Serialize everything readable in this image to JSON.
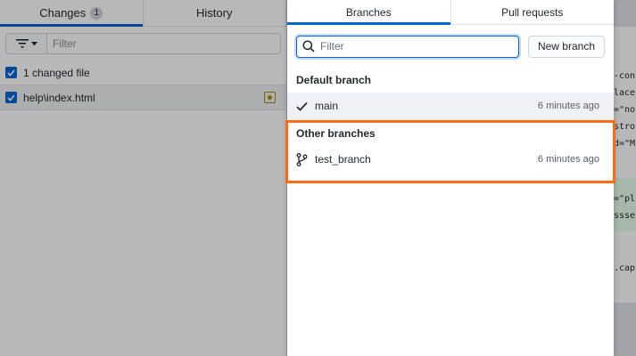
{
  "left_pane": {
    "tabs": [
      {
        "label": "Changes",
        "count": "1"
      },
      {
        "label": "History"
      }
    ],
    "filter_placeholder": "Filter",
    "changed_summary": "1 changed file",
    "files": [
      {
        "path": "help\\index.html",
        "status": "modified"
      }
    ]
  },
  "diff_snippets": [
    "-cont",
    "lacehc",
    "=\"non",
    "stro",
    "d=\"M",
    "=\"pl",
    "ssset",
    ".capt"
  ],
  "branch_popover": {
    "tabs": [
      {
        "label": "Branches"
      },
      {
        "label": "Pull requests"
      }
    ],
    "search_placeholder": "Filter",
    "new_branch_label": "New branch",
    "default_section": {
      "heading": "Default branch",
      "branches": [
        {
          "name": "main",
          "time": "6 minutes ago",
          "icon": "check-icon"
        }
      ]
    },
    "other_section": {
      "heading": "Other branches",
      "branches": [
        {
          "name": "test_branch",
          "time": "6 minutes ago",
          "icon": "git-branch-icon"
        }
      ]
    }
  },
  "colors": {
    "accent": "#0366d6",
    "highlight": "#ff6a13",
    "overlay": "rgba(0,0,0,0.28)"
  }
}
